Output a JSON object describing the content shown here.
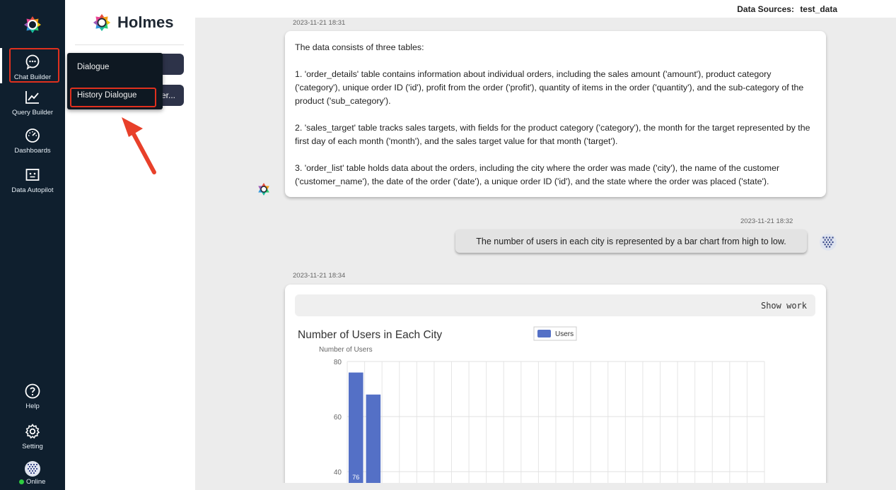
{
  "nav": {
    "items": [
      {
        "label": "Chat Builder",
        "icon": "chat-icon"
      },
      {
        "label": "Query Builder",
        "icon": "line-chart-icon"
      },
      {
        "label": "Dashboards",
        "icon": "gauge-icon"
      },
      {
        "label": "Data Autopilot",
        "icon": "robot-icon"
      }
    ],
    "bottom": [
      {
        "label": "Help",
        "icon": "help-icon"
      },
      {
        "label": "Setting",
        "icon": "gear-icon"
      }
    ],
    "status": "Online"
  },
  "brand": {
    "name": "Holmes"
  },
  "panel": {
    "button_truncated": "er..."
  },
  "dropdown": {
    "items": [
      "Dialogue",
      "History Dialogue"
    ]
  },
  "header": {
    "data_sources_label": "Data Sources:",
    "data_source": "test_data"
  },
  "messages": {
    "m1": {
      "timestamp": "2023-11-21 18:31",
      "paragraphs": [
        "The data consists of three tables:",
        "1. 'order_details' table contains information about individual orders, including the sales amount ('amount'), product category ('category'), unique order ID ('id'), profit from the order ('profit'), quantity of items in the order ('quantity'), and the sub-category of the product ('sub_category').",
        "2. 'sales_target' table tracks sales targets, with fields for the product category ('category'), the month for the target represented by the first day of each month ('month'), and the sales target value for that month ('target').",
        "3. 'order_list' table holds data about the orders, including the city where the order was made ('city'), the name of the customer ('customer_name'), the date of the order ('date'), a unique order ID ('id'), and the state where the order was placed ('state')."
      ]
    },
    "m2": {
      "timestamp": "2023-11-21 18:32",
      "text": "The number of users in each city is represented by a bar chart from high to low."
    },
    "m3": {
      "timestamp": "2023-11-21 18:34",
      "show_work": "Show work"
    }
  },
  "colors": {
    "nav_bg": "#0f1f2e",
    "accent_bar": "#5470c6",
    "highlight": "#e0301e",
    "online": "#2ecc40"
  },
  "chart_data": {
    "type": "bar",
    "title": "Number of Users in Each City",
    "ylabel": "Number of Users",
    "legend": [
      "Users"
    ],
    "legend_position": "top-center",
    "ylim": [
      40,
      80
    ],
    "yticks": [
      40,
      60,
      80
    ],
    "grid": true,
    "categories_visible": 2,
    "series": [
      {
        "name": "Users",
        "values": [
          76,
          68
        ]
      }
    ],
    "data_labels": [
      "76"
    ]
  }
}
